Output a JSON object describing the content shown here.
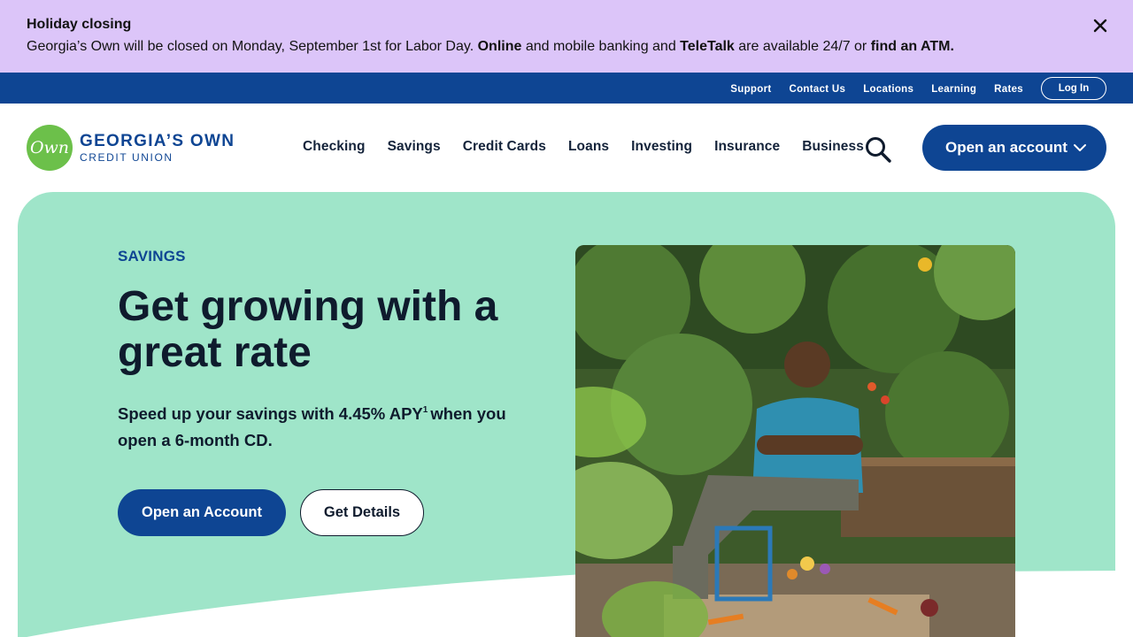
{
  "alert": {
    "title": "Holiday closing",
    "text_before_online": "Georgia’s Own will be closed on Monday, September 1st for Labor Day. ",
    "online": "Online",
    "text_mid": " and mobile banking and ",
    "teletalk": "TeleTalk",
    "text_after": " are available 24/7 or ",
    "atm_link": "find an ATM."
  },
  "utility": {
    "links": [
      "Support",
      "Contact Us",
      "Locations",
      "Learning",
      "Rates"
    ],
    "login": "Log In"
  },
  "logo": {
    "mark": "Own",
    "line1": "GEORGIA’S OWN",
    "line2": "CREDIT UNION"
  },
  "nav": {
    "items": [
      "Checking",
      "Savings",
      "Credit Cards",
      "Loans",
      "Investing",
      "Insurance",
      "Business"
    ],
    "open_account": "Open an account"
  },
  "hero": {
    "eyebrow": "SAVINGS",
    "headline": "Get growing with a great rate",
    "subtext_before": "Speed up your savings with 4.45% APY",
    "footnote": "1",
    "subtext_after": "when you open a 6-month CD.",
    "primary_button": "Open an Account",
    "secondary_button": "Get Details"
  },
  "colors": {
    "brand_blue": "#0e4593",
    "alert_purple": "#dcc5f9",
    "hero_mint": "#9fe5c9",
    "logo_green": "#6cc04a"
  },
  "icons": {
    "close": "close-icon",
    "search": "search-icon",
    "chevron": "chevron-down-icon"
  }
}
